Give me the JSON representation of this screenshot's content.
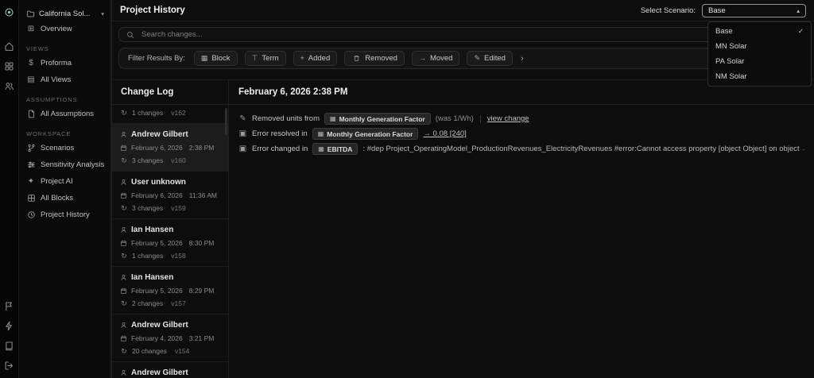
{
  "icons": {
    "chevron_down": "▾",
    "chevron_up": "▴",
    "chevron_right": "›",
    "check": "✓",
    "plus": "+",
    "arrow_right": "→",
    "pencil": "✎",
    "block": "▦",
    "block_alt": "▣",
    "term": "⊤",
    "dollar": "$",
    "sparkle": "✦",
    "grid": "⊞",
    "table": "▤",
    "rotate": "↻"
  },
  "rail_icon_names": [
    "app-logo",
    "home-icon",
    "projects-icon",
    "users-icon",
    "feedback-icon",
    "assistant-icon",
    "docs-icon",
    "logout-icon"
  ],
  "sidebar": {
    "project_name": "California Sol...",
    "overview": "Overview",
    "views_header": "VIEWS",
    "proforma": "Proforma",
    "all_views": "All Views",
    "assumptions_header": "ASSUMPTIONS",
    "all_assumptions": "All Assumptions",
    "workspace_header": "WORKSPACE",
    "scenarios": "Scenarios",
    "sensitivity_analysis": "Sensitivity Analysis",
    "project_ai": "Project AI",
    "all_blocks": "All Blocks",
    "project_history": "Project History"
  },
  "header": {
    "title": "Project History",
    "scenario_label": "Select Scenario:",
    "scenario_value": "Base"
  },
  "scenario_menu": {
    "options": [
      {
        "label": "Base",
        "selected": true
      },
      {
        "label": "MN Solar",
        "selected": false
      },
      {
        "label": "PA Solar",
        "selected": false
      },
      {
        "label": "NM Solar",
        "selected": false
      }
    ]
  },
  "search": {
    "placeholder": "Search changes..."
  },
  "filters": {
    "label": "Filter Results By:",
    "block": "Block",
    "term": "Term",
    "added": "Added",
    "removed": "Removed",
    "moved": "Moved",
    "edited": "Edited"
  },
  "changelog": {
    "title": "Change Log",
    "top_partial": {
      "changes": "1 changes",
      "version": "v162"
    },
    "entries": [
      {
        "name": "Andrew Gilbert",
        "date": "February 6, 2026",
        "time": "2:38 PM",
        "changes": "3 changes",
        "version": "v160"
      },
      {
        "name": "User unknown",
        "date": "February 6, 2026",
        "time": "11:36 AM",
        "changes": "3 changes",
        "version": "v159"
      },
      {
        "name": "Ian Hansen",
        "date": "February 5, 2026",
        "time": "8:30 PM",
        "changes": "1 changes",
        "version": "v158"
      },
      {
        "name": "Ian Hansen",
        "date": "February 5, 2026",
        "time": "8:29 PM",
        "changes": "2 changes",
        "version": "v157"
      },
      {
        "name": "Andrew Gilbert",
        "date": "February 4, 2026",
        "time": "3:21 PM",
        "changes": "20 changes",
        "version": "v154"
      },
      {
        "name": "Andrew Gilbert"
      }
    ]
  },
  "details": {
    "title": "February 6, 2026 2:38 PM",
    "row1": {
      "action": "Removed units from",
      "chip": "Monthly Generation Factor",
      "was": "(was 1/Wh)",
      "link": "view change"
    },
    "row2": {
      "action": "Error resolved in",
      "chip": "Monthly Generation Factor",
      "link": "→ 0.08 [240]"
    },
    "row3": {
      "action": "Error changed in",
      "chip": "EBITDA",
      "text": ": #dep Project_OperatingModel_ProductionRevenues_ElectricityRevenues #error:Cannot access property [object Object] on object → #error:add: Cannot convert unit \"USD\" to \"USD/I"
    }
  },
  "colors": {
    "background": "#0d0d0d",
    "panel": "#131313",
    "border": "#242424",
    "text_primary": "#e2e2e2",
    "text_muted": "#8f8f8f",
    "selected_row": "#1c1c1c",
    "logo_accent": "#8fcdb4"
  }
}
